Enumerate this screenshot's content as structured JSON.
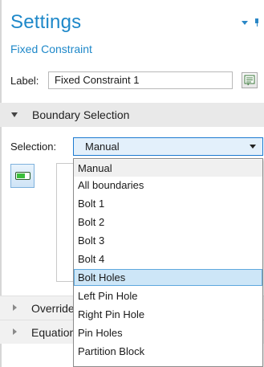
{
  "settings": {
    "title": "Settings",
    "subtitle": "Fixed Constraint",
    "header_icons": [
      "dropdown-arrow-icon",
      "pin-icon"
    ]
  },
  "label_row": {
    "label": "Label:",
    "value": "Fixed Constraint 1",
    "button_icon": "edit-label-icon"
  },
  "section": {
    "title": "Boundary Selection"
  },
  "selection": {
    "label": "Selection:",
    "value": "Manual",
    "options": [
      "Manual",
      "All boundaries",
      "Bolt 1",
      "Bolt 2",
      "Bolt 3",
      "Bolt 4",
      "Bolt Holes",
      "Left Pin Hole",
      "Right Pin Hole",
      "Pin Holes",
      "Partition Block"
    ],
    "highlighted_option": "Bolt Holes",
    "toggle_icon": "active-toggle-icon"
  },
  "collapsed_sections": {
    "override": "Override and Contribution",
    "equation": "Equation"
  },
  "colors": {
    "accent": "#1e88c9",
    "section_bg": "#e9e9e9",
    "select_bg": "#e3f0fb",
    "highlight_bg": "#cde6f7",
    "toggle_green": "#3bbf3b"
  }
}
